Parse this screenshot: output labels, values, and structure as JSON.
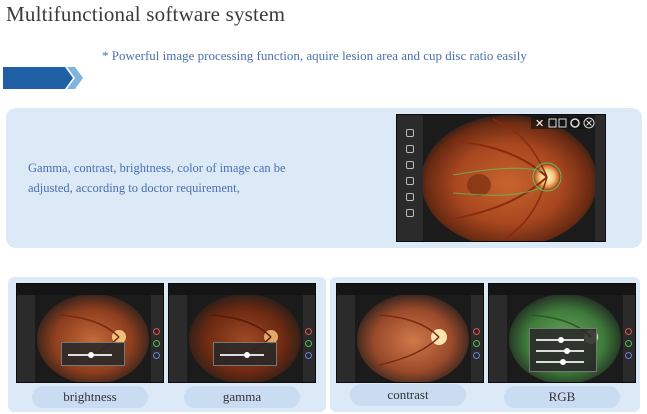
{
  "title": "Multifunctional software system",
  "tagline": "* Powerful image processing function, aquire lesion area and cup disc ratio easily",
  "feature_text": "Gamma, contrast, brightness, color of image can be adjusted, according to doctor requirement,",
  "captions": [
    "brightness",
    "gamma",
    "contrast",
    "RGB"
  ],
  "colors": {
    "accent_blue": "#4a6fb0",
    "panel_bg": "#dce9f7",
    "caption_bg": "#c9dcf2",
    "arrow_dark": "#1f5fa5",
    "arrow_light": "#7fb3e0"
  },
  "icons": [
    "close-icon",
    "save-icon",
    "zoom-icon",
    "circle-icon",
    "settings-icon"
  ]
}
